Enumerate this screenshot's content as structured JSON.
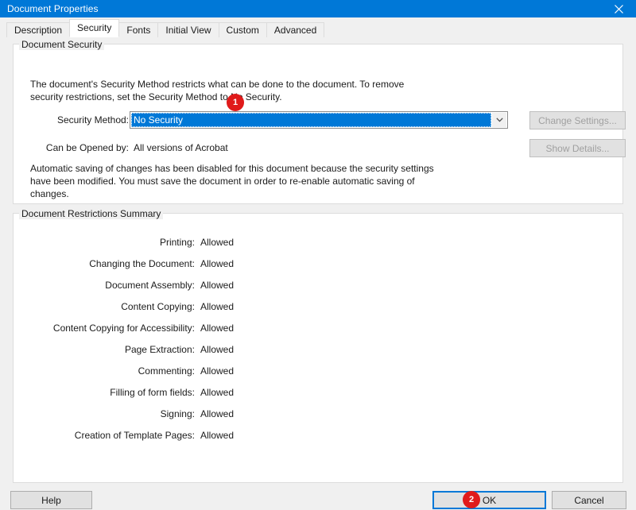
{
  "window": {
    "title": "Document Properties",
    "close_icon": "close-icon"
  },
  "tabs": [
    {
      "label": "Description",
      "active": false
    },
    {
      "label": "Security",
      "active": true
    },
    {
      "label": "Fonts",
      "active": false
    },
    {
      "label": "Initial View",
      "active": false
    },
    {
      "label": "Custom",
      "active": false
    },
    {
      "label": "Advanced",
      "active": false
    }
  ],
  "document_security": {
    "legend": "Document Security",
    "description": "The document's Security Method restricts what can be done to the document. To remove security restrictions, set the Security Method to No Security.",
    "security_method_label": "Security Method:",
    "security_method_value": "No Security",
    "security_method_options": [
      "No Security"
    ],
    "dropdown_icon": "chevron-down-icon",
    "can_be_opened_by_label": "Can be Opened by:",
    "can_be_opened_by_value": "All versions of Acrobat",
    "change_settings_label": "Change Settings...",
    "show_details_label": "Show Details...",
    "warning": "Automatic saving of changes has been disabled for this document because the security settings have been modified. You must save the document in order to re-enable automatic saving of changes."
  },
  "restrictions": {
    "legend": "Document Restrictions Summary",
    "rows": [
      {
        "label": "Printing:",
        "value": "Allowed"
      },
      {
        "label": "Changing the Document:",
        "value": "Allowed"
      },
      {
        "label": "Document Assembly:",
        "value": "Allowed"
      },
      {
        "label": "Content Copying:",
        "value": "Allowed"
      },
      {
        "label": "Content Copying for Accessibility:",
        "value": "Allowed"
      },
      {
        "label": "Page Extraction:",
        "value": "Allowed"
      },
      {
        "label": "Commenting:",
        "value": "Allowed"
      },
      {
        "label": "Filling of form fields:",
        "value": "Allowed"
      },
      {
        "label": "Signing:",
        "value": "Allowed"
      },
      {
        "label": "Creation of Template Pages:",
        "value": "Allowed"
      }
    ]
  },
  "footer": {
    "help_label": "Help",
    "ok_label": "OK",
    "cancel_label": "Cancel"
  },
  "annotations": [
    {
      "number": "1"
    },
    {
      "number": "2"
    }
  ],
  "colors": {
    "titlebar": "#0078d7",
    "accent": "#0078d7",
    "badge": "#e01b1b",
    "dialog_bg": "#f0f0f0",
    "group_bg": "#ffffff"
  }
}
